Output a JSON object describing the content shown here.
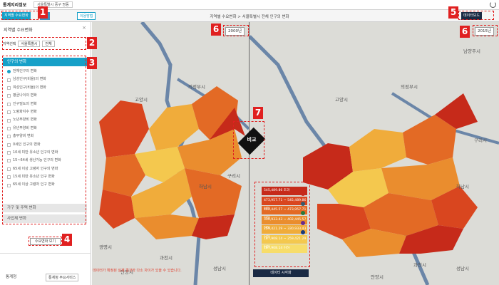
{
  "topbar": {
    "logo": "통계지리정보",
    "location_select": "서울특별시 중구 명동"
  },
  "toolbar": {
    "region_change_btn": "지역별 수요변화",
    "btn2": "▽도",
    "btn3": "이용방법",
    "center_title": "지역별 수요변화 > 서울특별시 전체 인구의 변화",
    "data_board_btn": "데이터보드"
  },
  "sidebar": {
    "title": "지역별 수요변화",
    "close": "×",
    "region_label": "지역선택",
    "region_city": "서울특별시",
    "region_district": "전체",
    "category_active": "인구의 변화",
    "items": [
      "전체인구의 변화",
      "남성인구(비율)의 변화",
      "여성인구(비율)의 변화",
      "평균나이의 변화",
      "인구밀도의 변화",
      "노령화지수 변화",
      "노년부양비 변화",
      "유년부양비 변화",
      "총부양비 변화",
      "0세인 인구의 변화",
      "10세 미만 유소년 인구의 변화",
      "15~64세 생산가능 인구의 변화",
      "65세 이상 고령자 인구의 변화",
      "15세 미만 유소년 인구 변화",
      "65세 이상 고령자 인구 변화"
    ],
    "category_household": "가구 및 주택 변화",
    "category_business": "사업체 변화",
    "view_button": "수요변화 보기",
    "footer_org": "통계청",
    "footer_link": "통계청 주요서비스"
  },
  "map_left": {
    "year": "2000년",
    "labels": [
      "의정부시",
      "고양시",
      "구리시",
      "하남시",
      "과천시",
      "안양시",
      "성남시",
      "광명시"
    ]
  },
  "map_right": {
    "year": "2015년",
    "labels": [
      "의정부시",
      "고양시",
      "구리시",
      "하남시",
      "과천시",
      "안양시",
      "성남시",
      "남양주시"
    ]
  },
  "swap_button": "비교",
  "legend": {
    "rows": [
      {
        "label": "545,489.86 초과",
        "color": "#c62a1a"
      },
      {
        "label": "473,957.71 ~ 545,489.86 이하",
        "color": "#d9461f"
      },
      {
        "label": "402,445.57 ~ 473,957.71 이하",
        "color": "#e36a25"
      },
      {
        "label": "330,933.43 ~ 402,445.57 이하",
        "color": "#ea8d2e"
      },
      {
        "label": "259,421.29 ~ 330,933.43 이하",
        "color": "#f0ac3b"
      },
      {
        "label": "187,908.14 ~ 259,421.29 이하",
        "color": "#f4c84e"
      },
      {
        "label": "187,908.14 이하",
        "color": "#f7dd6a"
      }
    ],
    "dots": [
      "#c62a1a",
      "#3a5a6a",
      "#2a7a3a",
      "#6a2a8a",
      "#1a3a7a"
    ],
    "footer_btn": "데이터 시각화"
  },
  "note": "데이터가 확정된 실제 결과와 다소 차이가 있을 수 있습니다.",
  "badges": [
    "1",
    "2",
    "3",
    "4",
    "5",
    "6",
    "6",
    "7"
  ]
}
